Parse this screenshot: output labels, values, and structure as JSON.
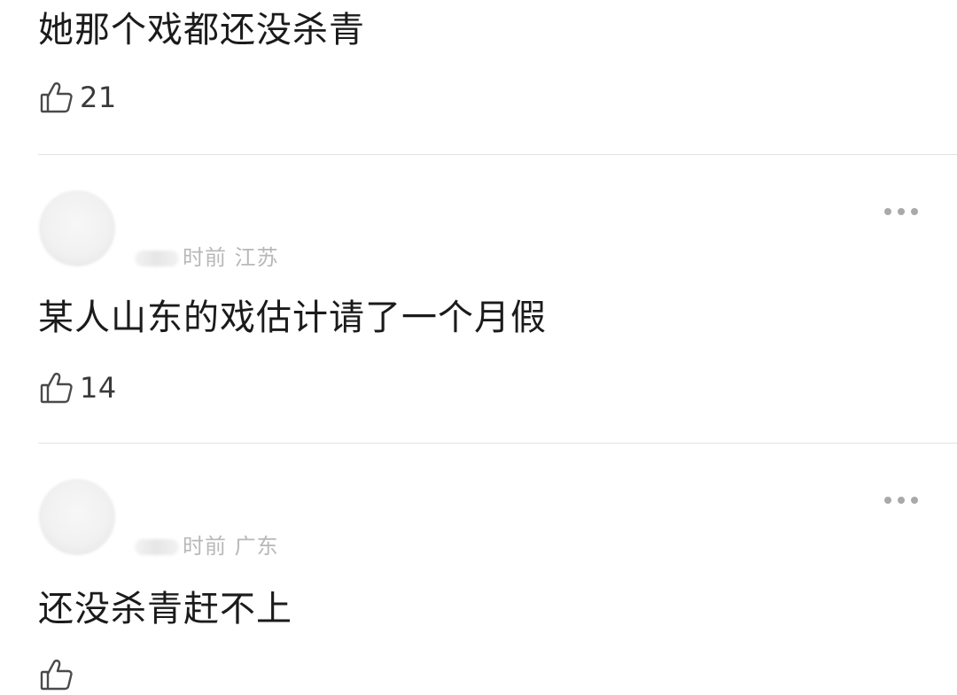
{
  "comments": [
    {
      "meta": "",
      "text": "她那个戏都还没杀青",
      "likes": "21"
    },
    {
      "meta": "时前 江苏",
      "text": "某人山东的戏估计请了一个月假",
      "likes": "14"
    },
    {
      "meta": "时前 广东",
      "text": "还没杀青赶不上",
      "likes": ""
    }
  ],
  "icons": {
    "like": "thumbs-up-icon",
    "more": "more-dots-icon"
  },
  "colors": {
    "text": "#1b1b1b",
    "meta": "#b8b8b8",
    "icon": "#4a4a4a",
    "divider": "#e2e2e2"
  }
}
